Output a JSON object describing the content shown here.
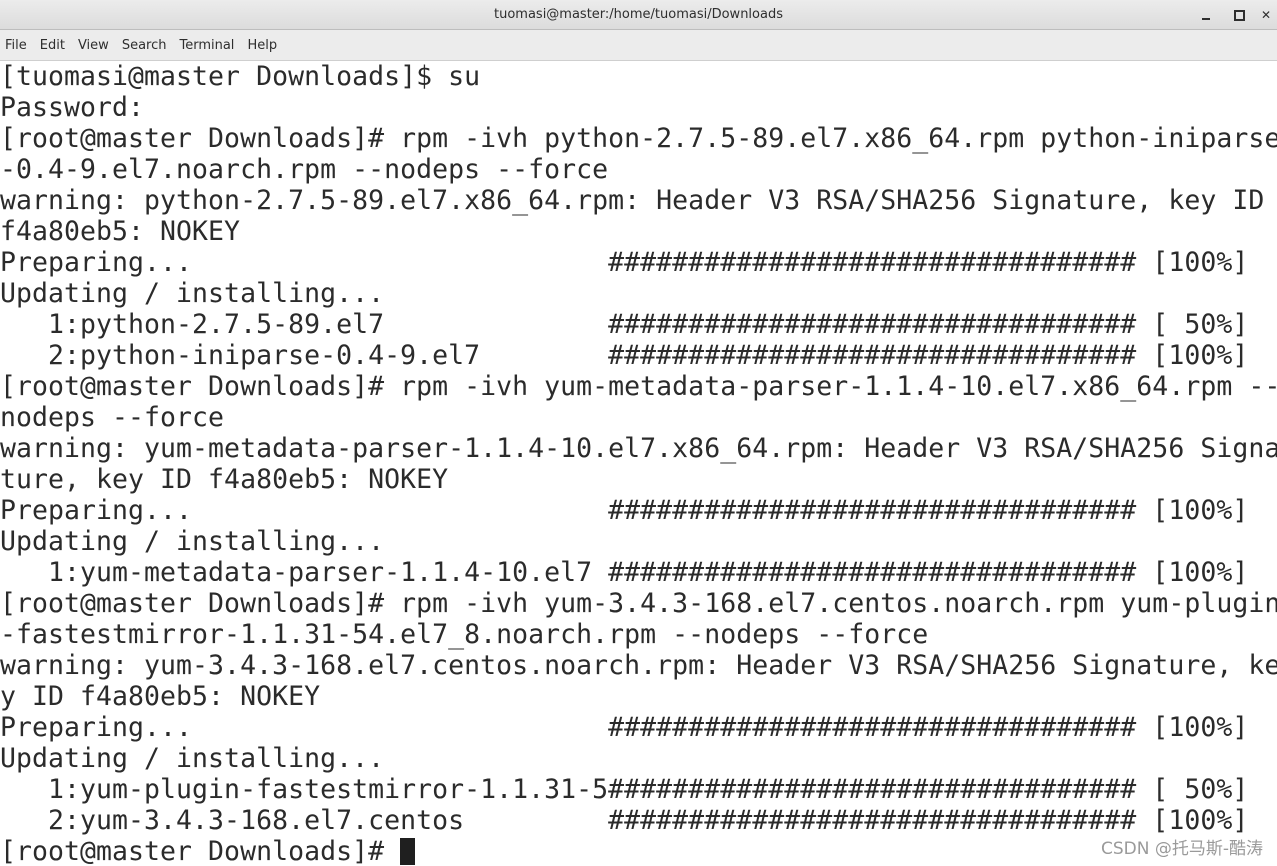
{
  "window": {
    "title": "tuomasi@master:/home/tuomasi/Downloads"
  },
  "menubar": {
    "items": [
      "File",
      "Edit",
      "View",
      "Search",
      "Terminal",
      "Help"
    ]
  },
  "terminal": {
    "lines": [
      "[tuomasi@master Downloads]$ su",
      "Password:",
      "[root@master Downloads]# rpm -ivh python-2.7.5-89.el7.x86_64.rpm python-iniparse",
      "-0.4-9.el7.noarch.rpm --nodeps --force",
      "warning: python-2.7.5-89.el7.x86_64.rpm: Header V3 RSA/SHA256 Signature, key ID ",
      "f4a80eb5: NOKEY",
      "Preparing...                          ################################# [100%]",
      "Updating / installing...",
      "   1:python-2.7.5-89.el7              ################################# [ 50%]",
      "   2:python-iniparse-0.4-9.el7        ################################# [100%]",
      "[root@master Downloads]# rpm -ivh yum-metadata-parser-1.1.4-10.el7.x86_64.rpm --",
      "nodeps --force",
      "warning: yum-metadata-parser-1.1.4-10.el7.x86_64.rpm: Header V3 RSA/SHA256 Signa",
      "ture, key ID f4a80eb5: NOKEY",
      "Preparing...                          ################################# [100%]",
      "Updating / installing...",
      "   1:yum-metadata-parser-1.1.4-10.el7 ################################# [100%]",
      "[root@master Downloads]# rpm -ivh yum-3.4.3-168.el7.centos.noarch.rpm yum-plugin",
      "-fastestmirror-1.1.31-54.el7_8.noarch.rpm --nodeps --force",
      "warning: yum-3.4.3-168.el7.centos.noarch.rpm: Header V3 RSA/SHA256 Signature, ke",
      "y ID f4a80eb5: NOKEY",
      "Preparing...                          ################################# [100%]",
      "Updating / installing...",
      "   1:yum-plugin-fastestmirror-1.1.31-5################################# [ 50%]",
      "   2:yum-3.4.3-168.el7.centos         ################################# [100%]"
    ],
    "prompt": "[root@master Downloads]# "
  },
  "watermark": {
    "text": "CSDN @托马斯-酷涛"
  }
}
